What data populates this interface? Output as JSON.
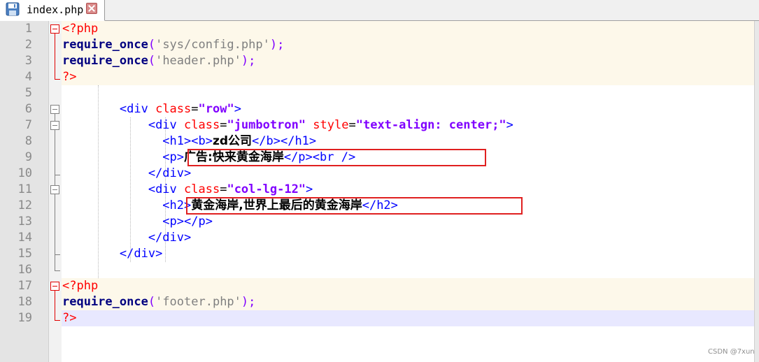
{
  "tab": {
    "filename": "index.php",
    "icons": {
      "save": "floppy-disk-icon",
      "close": "close-tab-icon"
    }
  },
  "line_numbers": [
    "1",
    "2",
    "3",
    "4",
    "5",
    "6",
    "7",
    "8",
    "9",
    "10",
    "11",
    "12",
    "13",
    "14",
    "15",
    "16",
    "17",
    "18",
    "19"
  ],
  "code": {
    "l1": {
      "open": "<?php"
    },
    "l2": {
      "kw": "require_once",
      "p1": "(",
      "str": "'sys/config.php'",
      "p2": ");"
    },
    "l3": {
      "kw": "require_once",
      "p1": "(",
      "str": "'header.php'",
      "p2": ");"
    },
    "l4": {
      "close": "?>"
    },
    "l6": {
      "indent": "        ",
      "t1": "<div ",
      "a1": "class",
      "eq": "=",
      "v1": "\"row\"",
      "t2": ">"
    },
    "l7": {
      "indent": "            ",
      "t1": "<div ",
      "a1": "class",
      "eq1": "=",
      "v1": "\"jumbotron\"",
      "sp": " ",
      "a2": "style",
      "eq2": "=",
      "v2": "\"text-align: center;\"",
      "t2": ">"
    },
    "l8": {
      "indent": "              ",
      "t1": "<h1><b>",
      "txt": "zd公司",
      "t2": "</b></h1>"
    },
    "l9": {
      "indent": "              ",
      "t1": "<p>",
      "txt": "广告:快来黄金海岸",
      "t2": "</p><br />"
    },
    "l10": {
      "indent": "            ",
      "t1": "</div>"
    },
    "l11": {
      "indent": "            ",
      "t1": "<div ",
      "a1": "class",
      "eq": "=",
      "v1": "\"col-lg-12\"",
      "t2": ">"
    },
    "l12": {
      "indent": "              ",
      "t1": "<h2>",
      "txt": "黄金海岸,世界上最后的黄金海岸",
      "t2": "</h2>"
    },
    "l13": {
      "indent": "              ",
      "t1": "<p></p>"
    },
    "l14": {
      "indent": "            ",
      "t1": "</div>"
    },
    "l15": {
      "indent": "        ",
      "t1": "</div>"
    },
    "l17": {
      "open": "<?php"
    },
    "l18": {
      "kw": "require_once",
      "p1": "(",
      "str": "'footer.php'",
      "p2": ");"
    },
    "l19": {
      "close": "?>"
    }
  },
  "colors": {
    "php_delim": "#ff0000",
    "keyword": "#000080",
    "string": "#808080",
    "html_tag": "#0000ff",
    "attribute": "#ff0000",
    "attr_value": "#8000ff",
    "highlight_box": "#e02020"
  },
  "watermark": "CSDN @7xun"
}
